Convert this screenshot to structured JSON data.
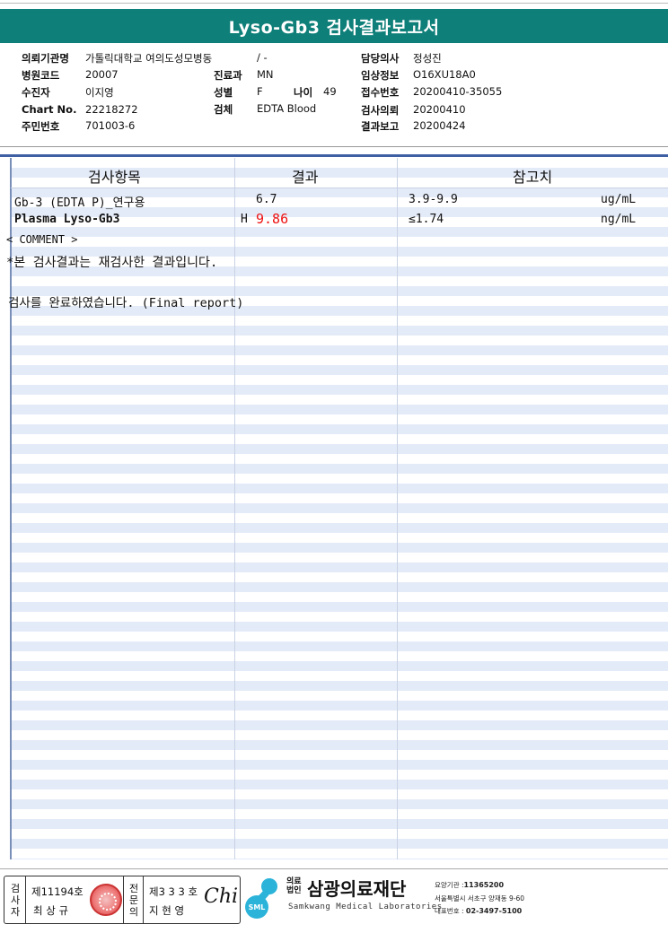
{
  "report": {
    "title": "Lyso-Gb3 검사결과보고서"
  },
  "info": {
    "institution_label": "의뢰기관명",
    "institution": "가톨릭대학교 여의도성모병동",
    "ward": "/ -",
    "doctor_label": "담당의사",
    "doctor": "정성진",
    "hospital_code_label": "병원코드",
    "hospital_code": "20007",
    "dept_label": "진료과",
    "dept": "MN",
    "clinical_label": "임상정보",
    "clinical": "O16XU18A0",
    "patient_label": "수진자",
    "patient": "이지영",
    "sex_label": "성별",
    "sex": "F",
    "age_label": "나이",
    "age": "49",
    "receipt_label": "접수번호",
    "receipt": "20200410-35055",
    "chart_label": "Chart No.",
    "chart": "22218272",
    "specimen_label": "검체",
    "specimen": "EDTA Blood",
    "request_date_label": "검사의뢰",
    "request_date": "20200410",
    "id_label": "주민번호",
    "id": "701003-6",
    "report_date_label": "결과보고",
    "report_date": "20200424"
  },
  "table": {
    "headers": {
      "item": "검사항목",
      "result": "결과",
      "reference": "참고치"
    },
    "rows": [
      {
        "item": "Gb-3 (EDTA P)_연구용",
        "flag": "",
        "result": "6.7",
        "reference": "3.9-9.9",
        "unit": "ug/mL"
      },
      {
        "item": "Plasma Lyso-Gb3",
        "flag": "H",
        "result": "9.86",
        "reference": "≤1.74",
        "unit": "ng/mL"
      }
    ],
    "comment_header": "< COMMENT >",
    "comment_line": "*본 검사결과는 재검사한 결과입니다.",
    "final_line": "검사를  완료하였습니다. (Final report)"
  },
  "signature": {
    "tester_label": "검사자",
    "tester_no": "제11194호",
    "tester_name": "최 상 규",
    "specialist_label": "전문의",
    "specialist_no": "제3 3 3 호",
    "specialist_name": "지 현 영",
    "specialist_sign": "Chi"
  },
  "organization": {
    "type": "의료법인",
    "name": "삼광의료재단",
    "english": "Samkwang Medical Laboratories",
    "logo_text": "SML",
    "code_label": "요양기관 :",
    "code": "11365200",
    "address": "서울특별시 서초구 양재동 9-60",
    "phone_label": "대표번호 :",
    "phone": "02-3497-5100"
  },
  "colors": {
    "title_bar": "#0f7f79",
    "flag_high": "#e11111",
    "accent_rule": "#3e5fa3"
  }
}
